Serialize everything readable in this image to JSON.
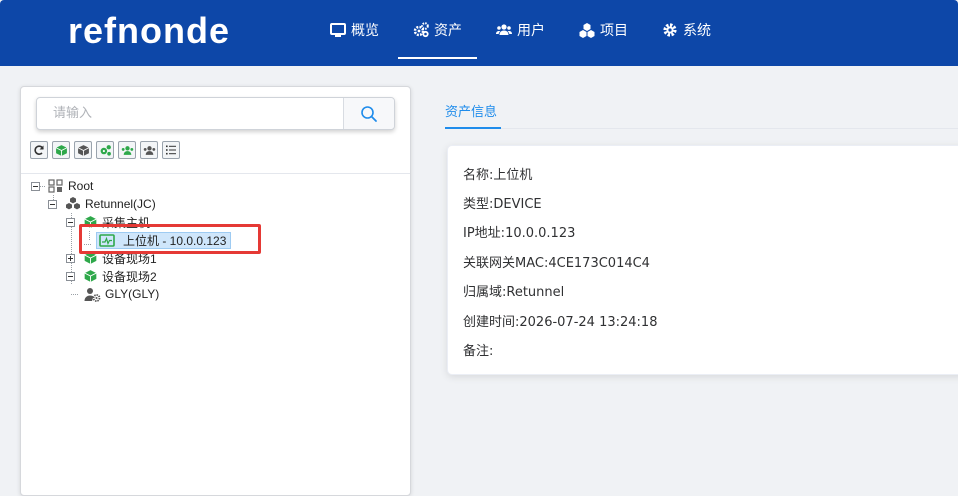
{
  "header": {
    "logo": "refnonde",
    "nav": [
      {
        "label": "概览",
        "icon": "monitor-icon",
        "active": false
      },
      {
        "label": "资产",
        "icon": "gears-icon",
        "active": true
      },
      {
        "label": "用户",
        "icon": "users-icon",
        "active": false
      },
      {
        "label": "项目",
        "icon": "cubes-icon",
        "active": false
      },
      {
        "label": "系统",
        "icon": "gear-icon",
        "active": false
      }
    ]
  },
  "sidebar": {
    "search": {
      "placeholder": "请输入"
    },
    "tools": [
      "refresh-icon",
      "cube-green-icon",
      "cube-gray-icon",
      "gears-green-icon",
      "users-green-icon",
      "users-gray-icon",
      "list-icon"
    ],
    "tree": {
      "root": "Root",
      "domain": "Retunnel(JC)",
      "group1": "采集主机",
      "selected_item": "上位机 - 10.0.0.123",
      "group2": "设备现场1",
      "group3": "设备现场2",
      "user": "GLY(GLY)"
    }
  },
  "detail": {
    "tab": "资产信息",
    "fields": [
      {
        "label": "名称:",
        "value": "上位机"
      },
      {
        "label": "类型:",
        "value": "DEVICE"
      },
      {
        "label": "IP地址:",
        "value": "10.0.0.123"
      },
      {
        "label": "关联网关MAC:",
        "value": "4CE173C014C4"
      },
      {
        "label": "归属域:",
        "value": "Retunnel"
      },
      {
        "label": "创建时间:",
        "value": "2026-07-24 13:24:18"
      },
      {
        "label": "备注:",
        "value": ""
      }
    ]
  },
  "colors": {
    "header": "#0d47a8",
    "accent": "#1f8ceb",
    "highlight": "#e53935",
    "asset_green": "#2ea84a"
  }
}
